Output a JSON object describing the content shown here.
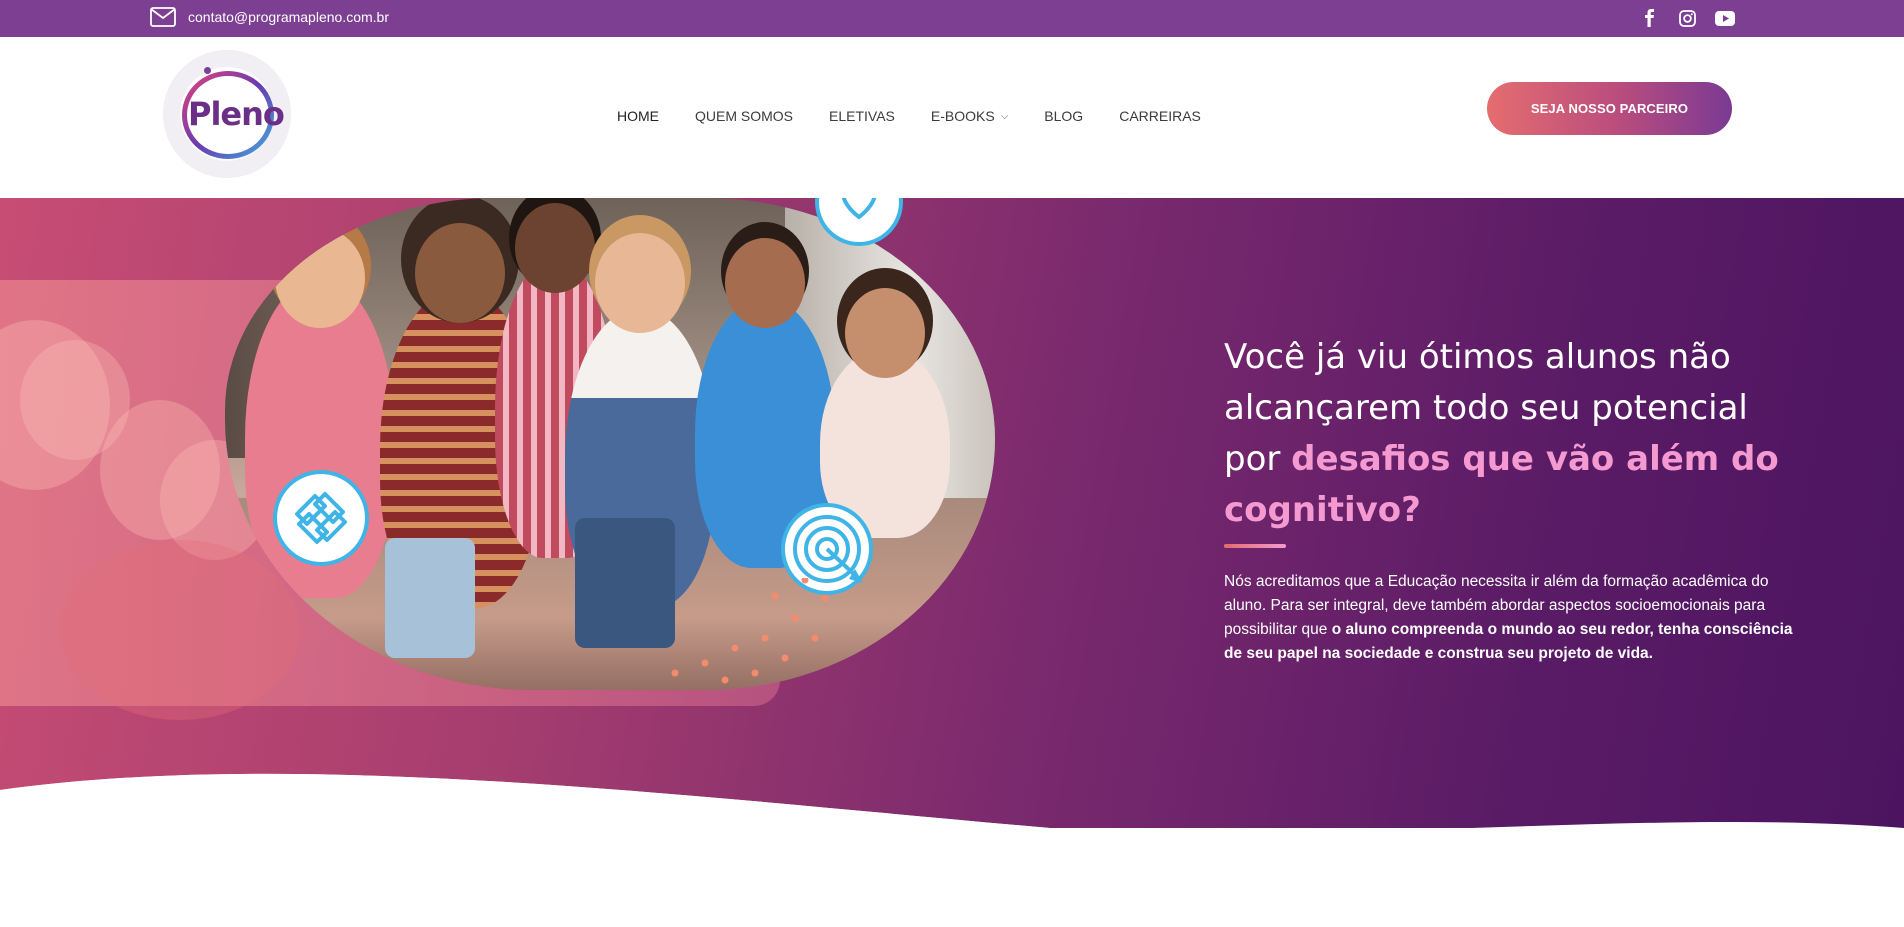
{
  "topbar": {
    "email": "contato@programapleno.com.br",
    "socials": [
      {
        "name": "facebook-icon",
        "glyph": "f"
      },
      {
        "name": "instagram-icon",
        "glyph": "◎"
      },
      {
        "name": "youtube-icon",
        "glyph": "▶"
      }
    ]
  },
  "header": {
    "logo_text": "Pleno",
    "nav": [
      {
        "label": "HOME"
      },
      {
        "label": "QUEM SOMOS"
      },
      {
        "label": "ELETIVAS"
      },
      {
        "label": "E-BOOKS"
      },
      {
        "label": "BLOG"
      },
      {
        "label": "CARREIRAS"
      }
    ],
    "cta_label": "SEJA NOSSO PARCEIRO"
  },
  "hero": {
    "headline_plain": "Você já viu ótimos alunos não alcançarem todo seu potencial por ",
    "headline_highlight": "desafios que vão além do cognitivo?",
    "paragraph_plain": "Nós acreditamos que a Educação necessita ir além da formação acadêmica do aluno. Para ser integral, deve também abordar aspectos socioemocionais para possibilitar que ",
    "paragraph_bold": "o aluno compreenda o mundo ao seu redor, tenha consciência de seu papel na sociedade e construa seu projeto de vida."
  },
  "colors": {
    "topbar": "#7d3f92",
    "accent_pink": "#f59ad0",
    "cta_start": "#e56d6f",
    "cta_end": "#7a3a93",
    "icon_blue": "#3fb4e6"
  }
}
